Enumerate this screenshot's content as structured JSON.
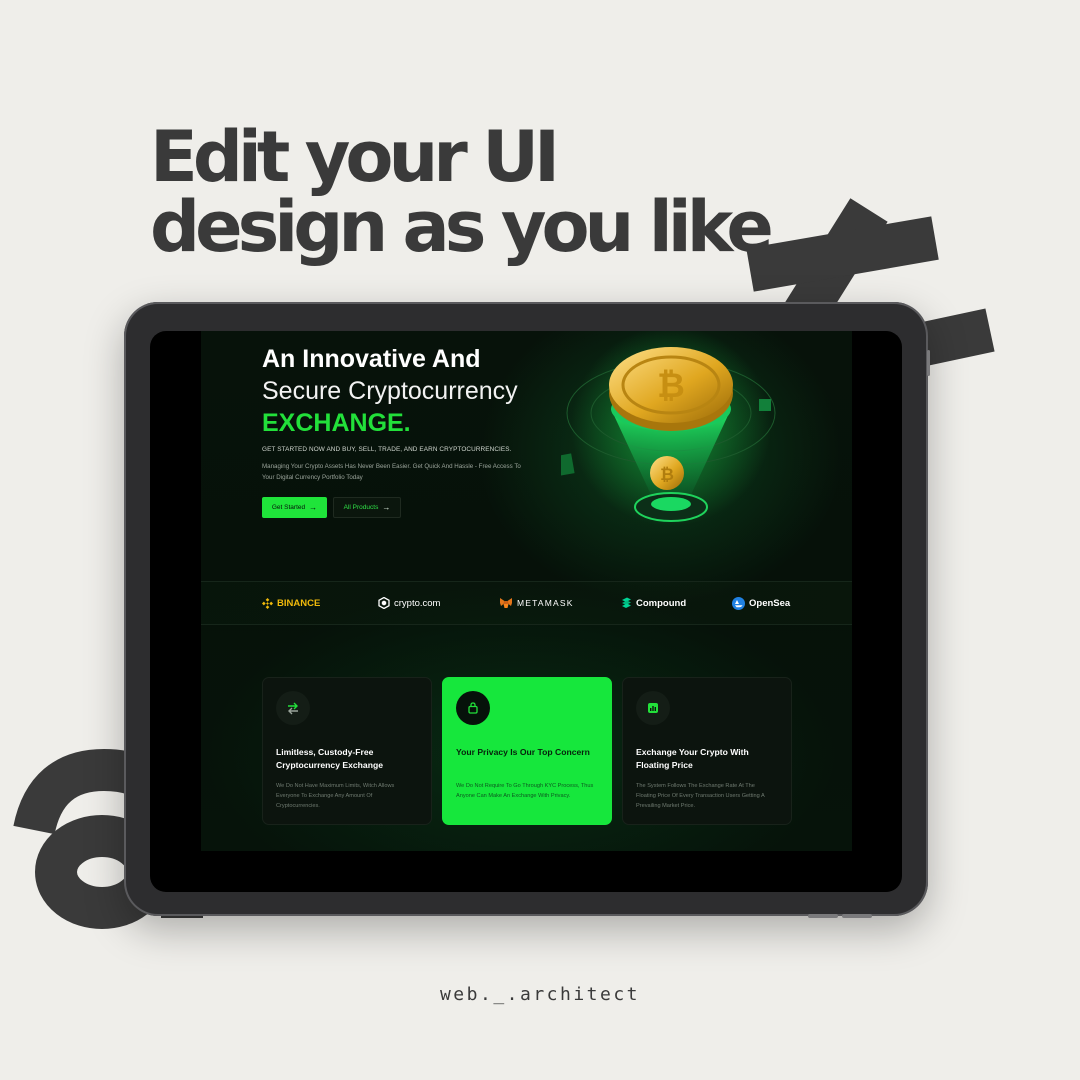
{
  "poster": {
    "headline_line1": "Edit your UI",
    "headline_line2": "design as you like",
    "deco_letters": [
      "a",
      "t"
    ],
    "brand": "web._.architect",
    "accent_color": "#1fe43a",
    "background_color": "#efeeea"
  },
  "hero": {
    "title_line1": "An Innovative And",
    "title_line2": "Secure Cryptocurrency",
    "title_line3": "EXCHANGE.",
    "tagline": "GET STARTED NOW AND BUY, SELL, TRADE, AND EARN CRYPTOCURRENCIES.",
    "description": "Managing Your Crypto Assets Has Never Been Easier. Get Quick And Hassle - Free Access To Your Digital Currency Portfolio Today",
    "primary_button": "Get Started",
    "secondary_button": "All Products",
    "arrow_icon": "→",
    "illustration_icon": "bitcoin-coin-icon"
  },
  "partners": [
    {
      "name": "BINANCE",
      "icon": "binance-logo-icon"
    },
    {
      "name": "crypto.com",
      "icon": "crypto-com-logo-icon"
    },
    {
      "name": "METAMASK",
      "icon": "metamask-fox-icon"
    },
    {
      "name": "Compound",
      "icon": "compound-logo-icon"
    },
    {
      "name": "OpenSea",
      "icon": "opensea-logo-icon"
    }
  ],
  "features": [
    {
      "title": "Limitless, Custody-Free Cryptocurrency Exchange",
      "description": "We Do Not Have Maximum Limits, Witch Allows Everyone To Exchange Any Amount Of Cryptocurrencies.",
      "icon": "exchange-icon",
      "active": false
    },
    {
      "title": "Your Privacy Is Our Top Concern",
      "description": "We Do Not Require To Go Through KYC Process, Thus Anyone Can Make An Exchange With Privacy.",
      "icon": "privacy-lock-icon",
      "active": true
    },
    {
      "title": "Exchange Your Crypto With Floating Price",
      "description": "The System Follows The Exchange Rate At The Floating Price Of Every Transaction Users Getting A Prevailing Market Price.",
      "icon": "chart-icon",
      "active": false
    }
  ]
}
